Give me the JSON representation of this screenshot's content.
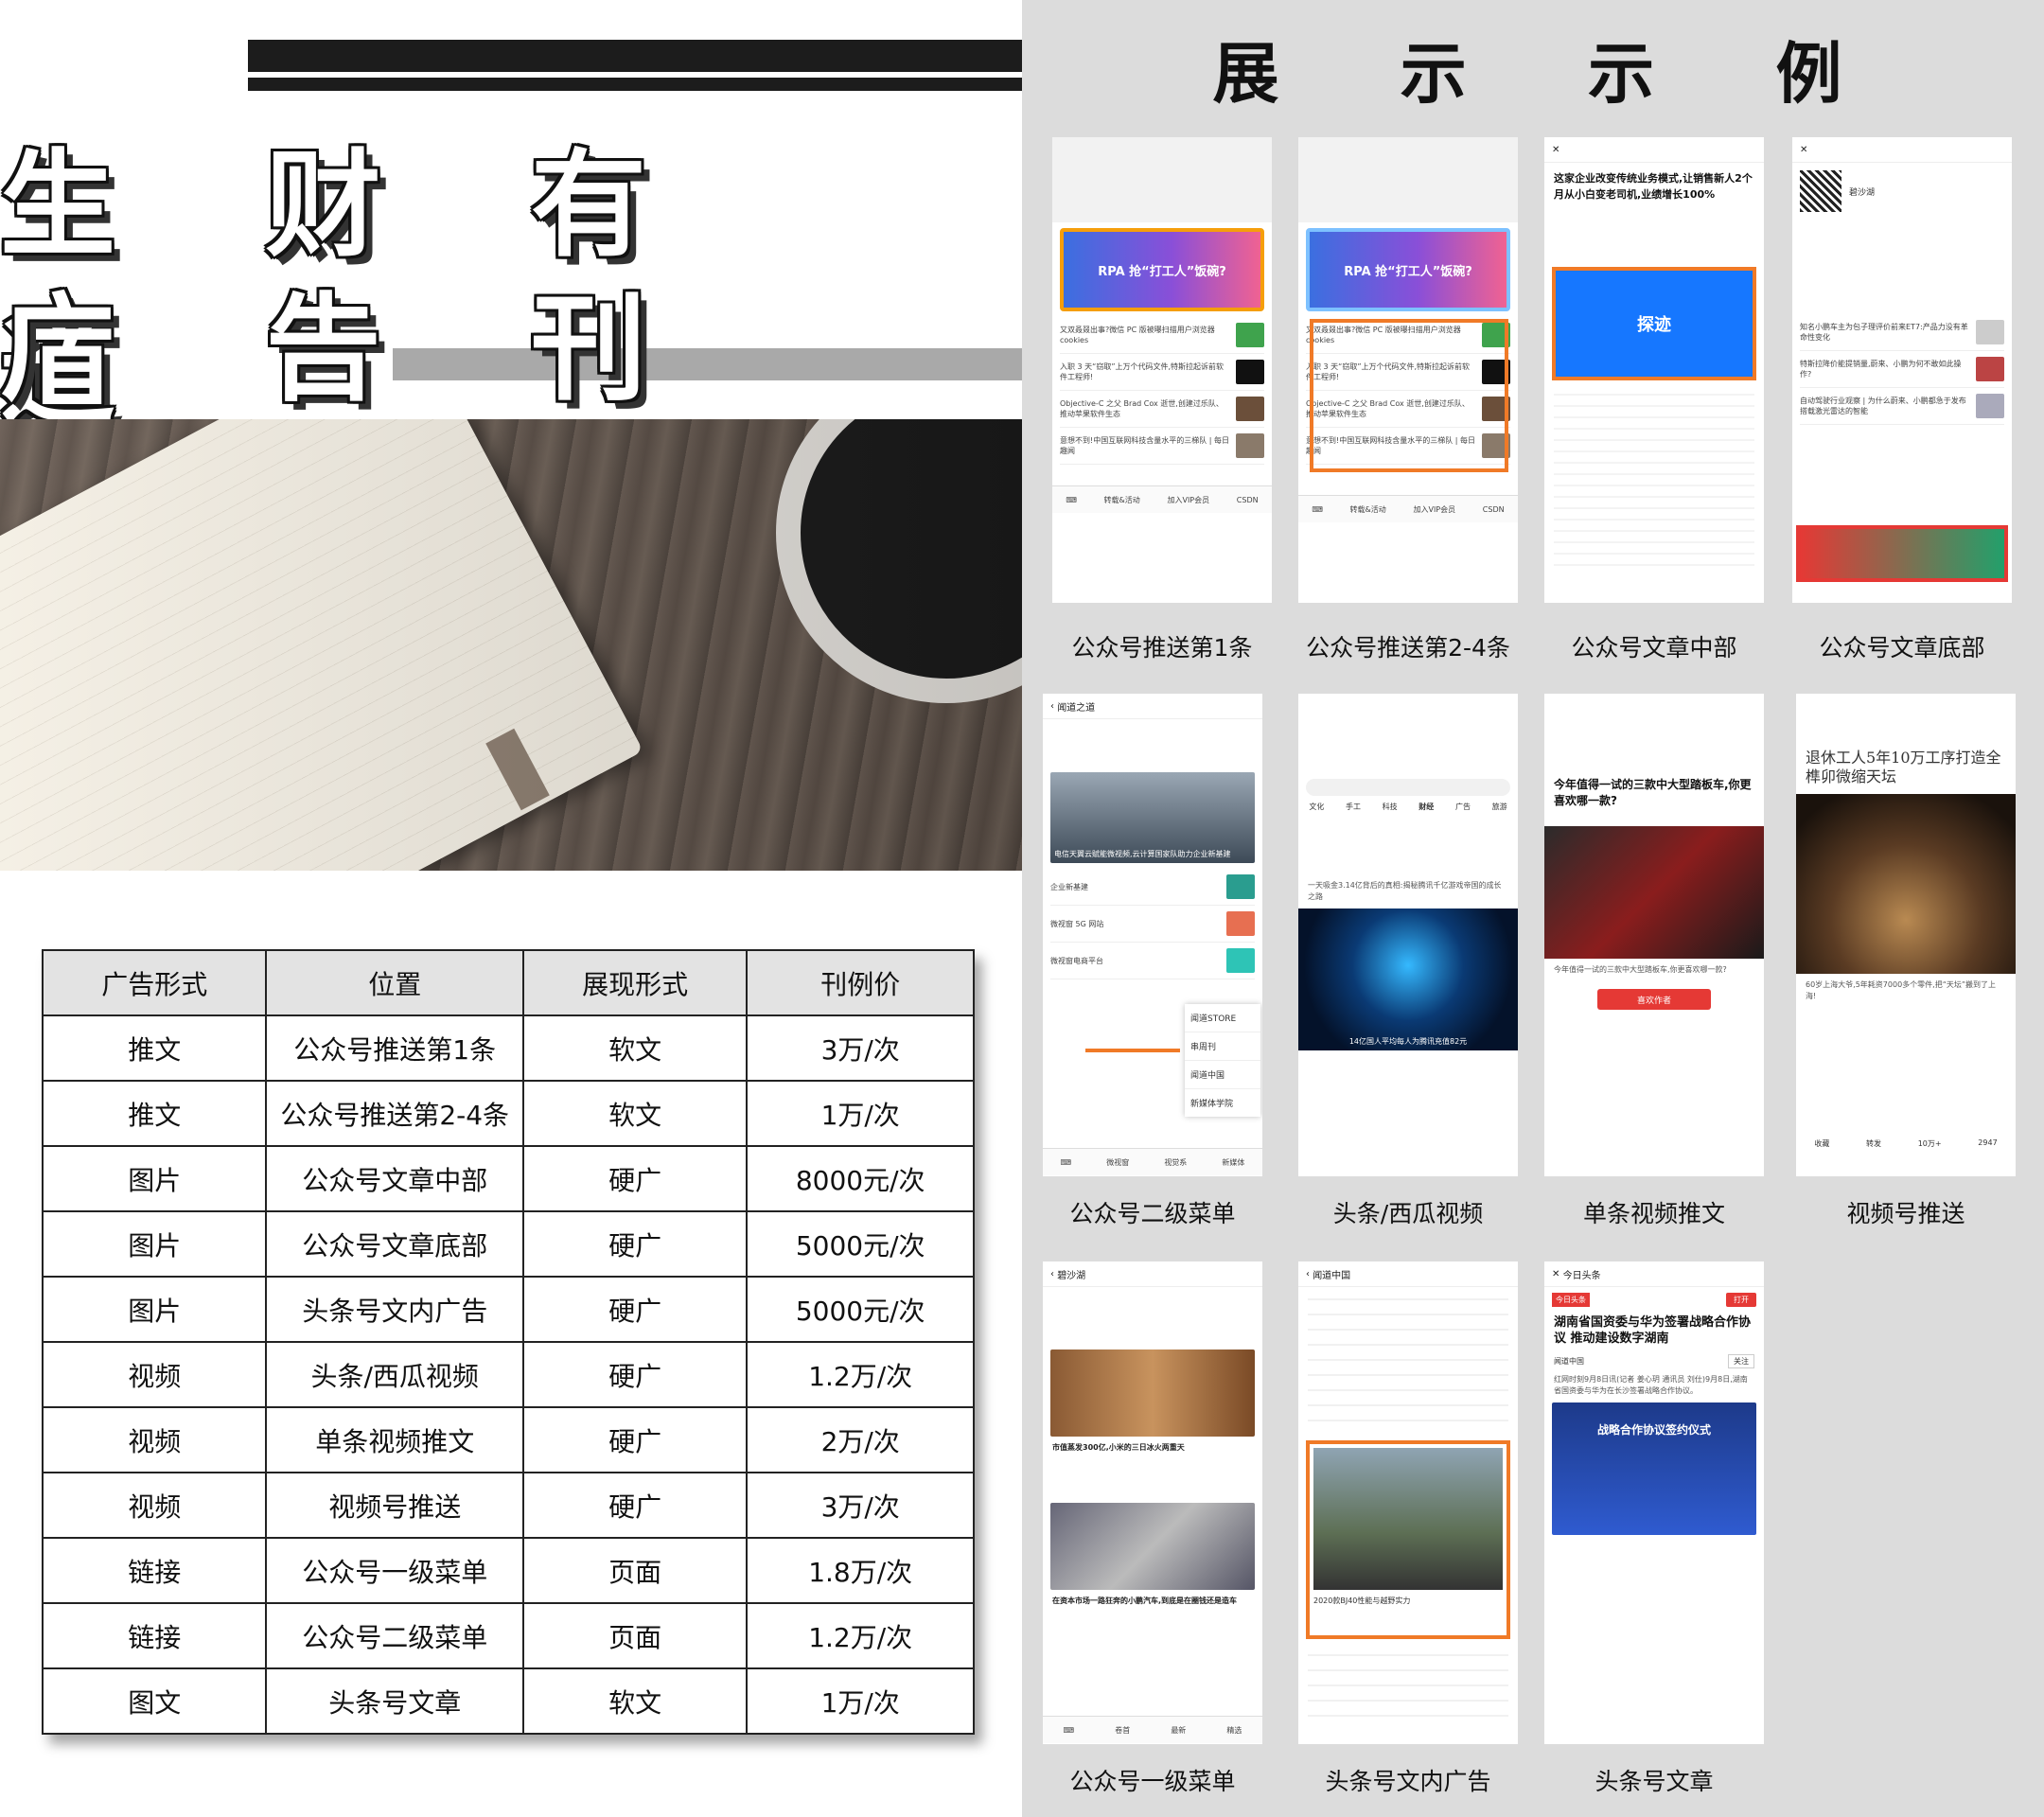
{
  "header": {
    "title_line1": "生 财 有 道",
    "title_line2": "广 告 刊 例"
  },
  "showcase": {
    "title": "展 示 示 例",
    "items": [
      {
        "caption": "公众号推送第1条"
      },
      {
        "caption": "公众号推送第2-4条"
      },
      {
        "caption": "公众号文章中部"
      },
      {
        "caption": "公众号文章底部"
      },
      {
        "caption": "公众号二级菜单"
      },
      {
        "caption": "头条/西瓜视频"
      },
      {
        "caption": "单条视频推文"
      },
      {
        "caption": "视频号推送"
      },
      {
        "caption": "公众号一级菜单"
      },
      {
        "caption": "头条号文内广告"
      },
      {
        "caption": "头条号文章"
      }
    ]
  },
  "table": {
    "headers": [
      "广告形式",
      "位置",
      "展现形式",
      "刊例价"
    ],
    "rows": [
      [
        "推文",
        "公众号推送第1条",
        "软文",
        "3万/次"
      ],
      [
        "推文",
        "公众号推送第2-4条",
        "软文",
        "1万/次"
      ],
      [
        "图片",
        "公众号文章中部",
        "硬广",
        "8000元/次"
      ],
      [
        "图片",
        "公众号文章底部",
        "硬广",
        "5000元/次"
      ],
      [
        "图片",
        "头条号文内广告",
        "硬广",
        "5000元/次"
      ],
      [
        "视频",
        "头条/西瓜视频",
        "硬广",
        "1.2万/次"
      ],
      [
        "视频",
        "单条视频推文",
        "硬广",
        "2万/次"
      ],
      [
        "视频",
        "视频号推送",
        "硬广",
        "3万/次"
      ],
      [
        "链接",
        "公众号一级菜单",
        "页面",
        "1.8万/次"
      ],
      [
        "链接",
        "公众号二级菜单",
        "页面",
        "1.2万/次"
      ],
      [
        "图文",
        "头条号文章",
        "软文",
        "1万/次"
      ]
    ]
  },
  "mock": {
    "rpa_banner": "RPA 抢“打工人”饭碗?",
    "rpa_rows": [
      "又双叒叕出事?微信 PC 版被曝扫描用户浏览器 cookies",
      "入职 3 天“窃取”上万个代码文件,特斯拉起诉前软件工程师!",
      "Objective-C 之父 Brad Cox 逝世,创建过乐队、推动苹果软件生态",
      "意想不到!中国互联网科技含量水平的三梯队 | 每日趣闻"
    ],
    "rpa_footer": [
      "转载&活动",
      "加入VIP会员",
      "CSDN"
    ],
    "mid_headline": "这家企业改变传统业务模式,让销售新人2个月从小白变老司机,业绩增长100%",
    "mid_ad": "探迹",
    "bottom_author": "碧沙湖",
    "bottom_rows": [
      "知名小鹏车主为包子理评价前来ET7:产品力没有革命性变化",
      "特斯拉降价能提销量,蔚来、小鹏为何不敢如此操作?",
      "自动驾驶行业观察 | 为什么蔚来、小鹏都急于发布搭载激光雷达的智能"
    ],
    "menu_title": "闻道之道",
    "menu_banner": "电信天翼云赋能微视频,云计算国家队助力企业新基建",
    "menu_rows": [
      "企业新基建",
      "微视窗 5G 网站",
      "微视窗电商平台"
    ],
    "menu_popup": [
      "闻道STORE",
      "串周刊",
      "闻道中国",
      "新媒体学院"
    ],
    "menu_footer": [
      "微视窗",
      "视觉系",
      "新媒体"
    ],
    "video_tabs": [
      "文化",
      "手工",
      "科技",
      "财经",
      "广告",
      "旅游"
    ],
    "video_caption": "14亿国人平均每人为腾讯充值82元",
    "video_text": "一天吸金3.14亿背后的真相:揭秘腾讯千亿游戏帝国的成长之路",
    "single_headline": "今年值得一试的三款中大型踏板车,你更喜欢哪一款?",
    "single_button": "喜欢作者",
    "channel_headline": "退休工人5年10万工序打造全榫卯微缩天坛",
    "channel_text": "60岁上海大爷,5年耗资7000多个零件,把“天坛”搬到了上海!",
    "channel_footer": [
      "收藏",
      "转发",
      "10万+",
      "2947"
    ],
    "toutiao_headline": "湖南省国资委与华为签署战略合作协议 推动建设数字湖南",
    "toutiao_tag": "今日头条",
    "toutiao_open": "打开",
    "toutiao_author": "闻道中国",
    "toutiao_follow": "关注",
    "toutiao_text": "红网时刻9月8日讯(记者 姜心玥 通讯员 刘仕)9月8日,湖南省国资委与华为在长沙签署战略合作协议。",
    "toutiao_banner": "战略合作协议签约仪式",
    "first_menu_author": "碧沙湖",
    "first_menu_title": "市值蒸发300亿,小米的三日冰火两重天",
    "first_menu_title2": "在资本市场一路狂奔的小鹏汽车,到底是在圈钱还是造车",
    "first_menu_footer": [
      "卷首",
      "最新",
      "精选"
    ],
    "in_article_text": "2020款BJ40性能与越野实力",
    "in_article_author": "闻道中国"
  },
  "colors": {
    "accent_orange": "#f07a27",
    "table_header_bg": "#e3e3e3",
    "right_bg": "#dcdcdc"
  }
}
